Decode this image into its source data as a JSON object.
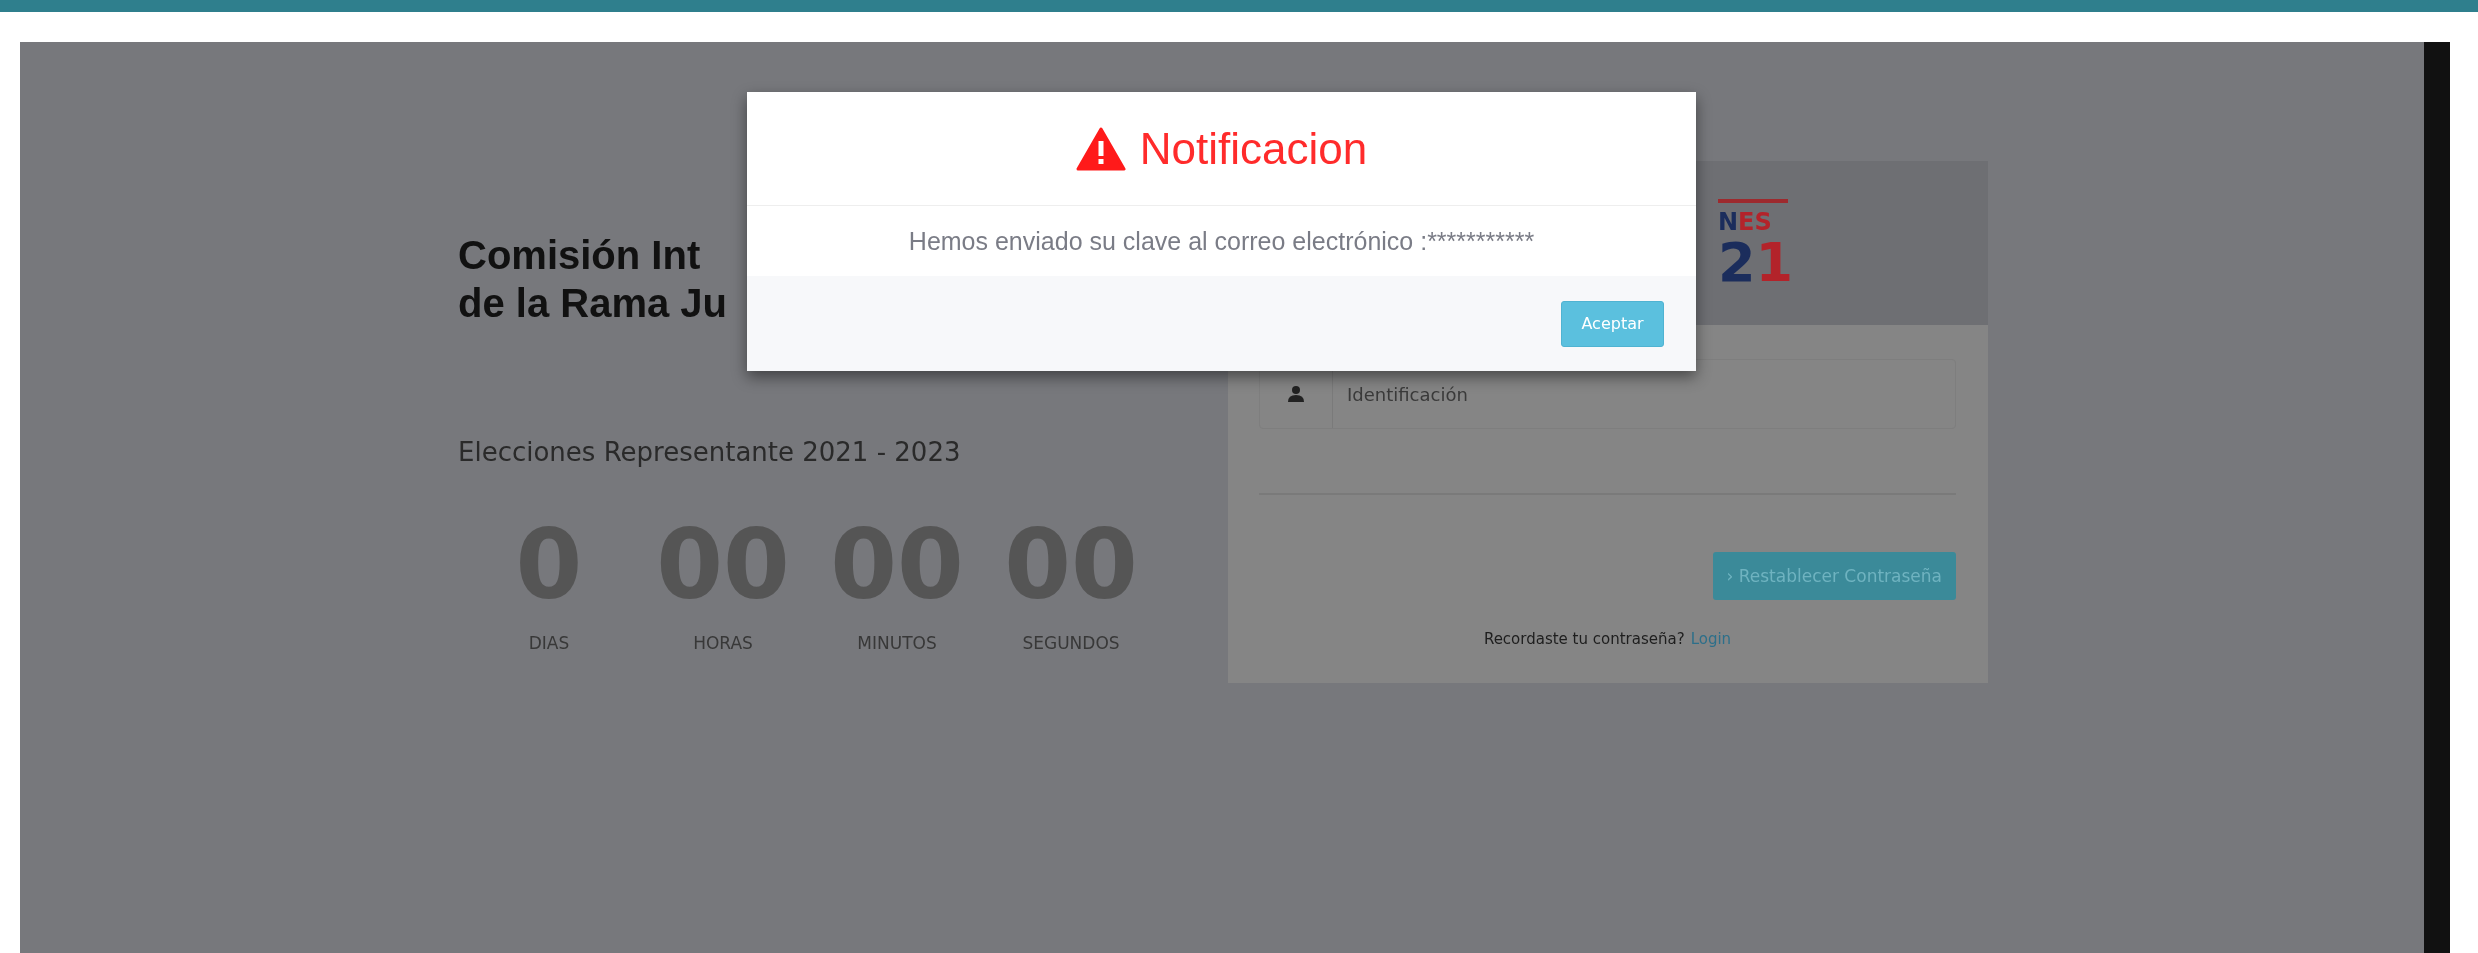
{
  "page": {
    "heading_lines": [
      "Comisión Int",
      "de la Rama Ju"
    ],
    "subtitle": "Elecciones Representante 2021 - 2023",
    "countdown": [
      {
        "value": "0",
        "unit": "DIAS"
      },
      {
        "value": "00",
        "unit": "HORAS"
      },
      {
        "value": "00",
        "unit": "MINUTOS"
      },
      {
        "value": "00",
        "unit": "SEGUNDOS"
      }
    ]
  },
  "login_panel": {
    "logo_lines": [
      [
        {
          "text": "N",
          "color": "#1b2d5c"
        },
        {
          "text": "ES",
          "color": "#b3232a"
        }
      ],
      [
        {
          "text": "2",
          "color": "#1b2d5c"
        },
        {
          "text": "1",
          "color": "#b3232a"
        }
      ]
    ],
    "id_field": {
      "placeholder": "Identificación"
    },
    "reset_button": "› Restablecer Contraseña",
    "remember_text": "Recordaste tu contraseña?",
    "login_link": "Login"
  },
  "modal": {
    "title": "Notificacion",
    "message": "Hemos enviado su clave al correo electrónico :***********",
    "button": "Aceptar"
  }
}
